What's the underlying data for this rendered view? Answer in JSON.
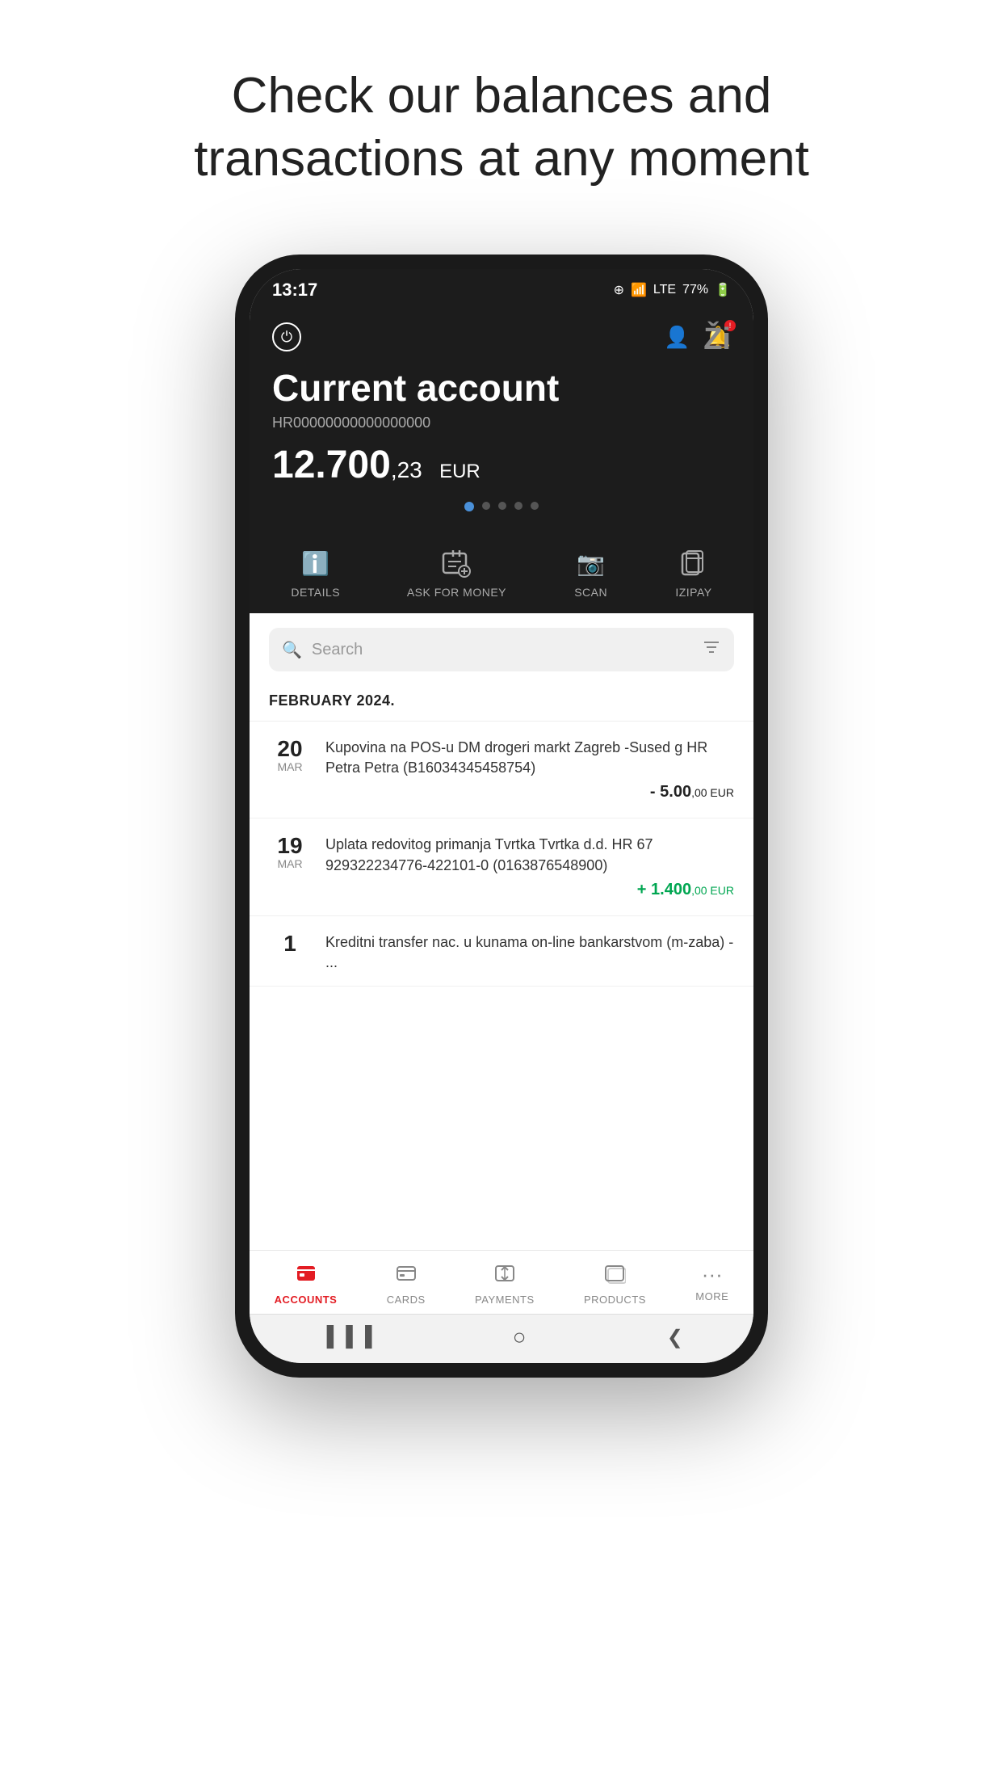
{
  "headline": {
    "line1": "Check our balances and",
    "line2": "transactions at any moment"
  },
  "statusBar": {
    "time": "13:17",
    "battery": "77%"
  },
  "header": {
    "accountType": "Current account",
    "iban": "HR00000000000000000",
    "balance": "12.700",
    "balanceDecimals": ",23",
    "currency": "EUR",
    "avatarLabel": "Ži"
  },
  "dots": [
    {
      "active": true
    },
    {
      "active": false
    },
    {
      "active": false
    },
    {
      "active": false
    },
    {
      "active": false
    }
  ],
  "quickActions": [
    {
      "icon": "ℹ",
      "label": "DETAILS"
    },
    {
      "icon": "⊞",
      "label": "ASK FOR MONEY"
    },
    {
      "icon": "📷",
      "label": "SCAN"
    },
    {
      "icon": "💳",
      "label": "IZIPAY"
    }
  ],
  "search": {
    "placeholder": "Search"
  },
  "monthHeader": "FEBRUARY 2024.",
  "transactions": [
    {
      "day": "20",
      "month": "MAR",
      "description": "Kupovina na POS-u DM drogeri markt Zagreb -Sused g HR Petra Petra (B16034345458754)",
      "amount": "- 5.00",
      "amountDecimals": ",00",
      "currency": "EUR",
      "type": "negative"
    },
    {
      "day": "19",
      "month": "MAR",
      "description": "Uplata redovitog primanja Tvrtka Tvrtka d.d. HR 67 929322234776-422101-0 (0163876548900)",
      "amount": "+ 1.400",
      "amountDecimals": ",00",
      "currency": "EUR",
      "type": "positive"
    },
    {
      "day": "1",
      "month": "",
      "description": "Kreditni transfer nac. u kunama on-line bankarstvom (m-zaba) - ...",
      "amount": "",
      "amountDecimals": "",
      "currency": "",
      "type": "negative"
    }
  ],
  "bottomNav": [
    {
      "label": "ACCOUNTS",
      "active": true
    },
    {
      "label": "CARDS",
      "active": false
    },
    {
      "label": "PAYMENTS",
      "active": false
    },
    {
      "label": "PRODUCTS",
      "active": false
    },
    {
      "label": "MORE",
      "active": false
    }
  ],
  "androidNav": {
    "back": "❮",
    "home": "○",
    "recent": "▐▐▐"
  }
}
